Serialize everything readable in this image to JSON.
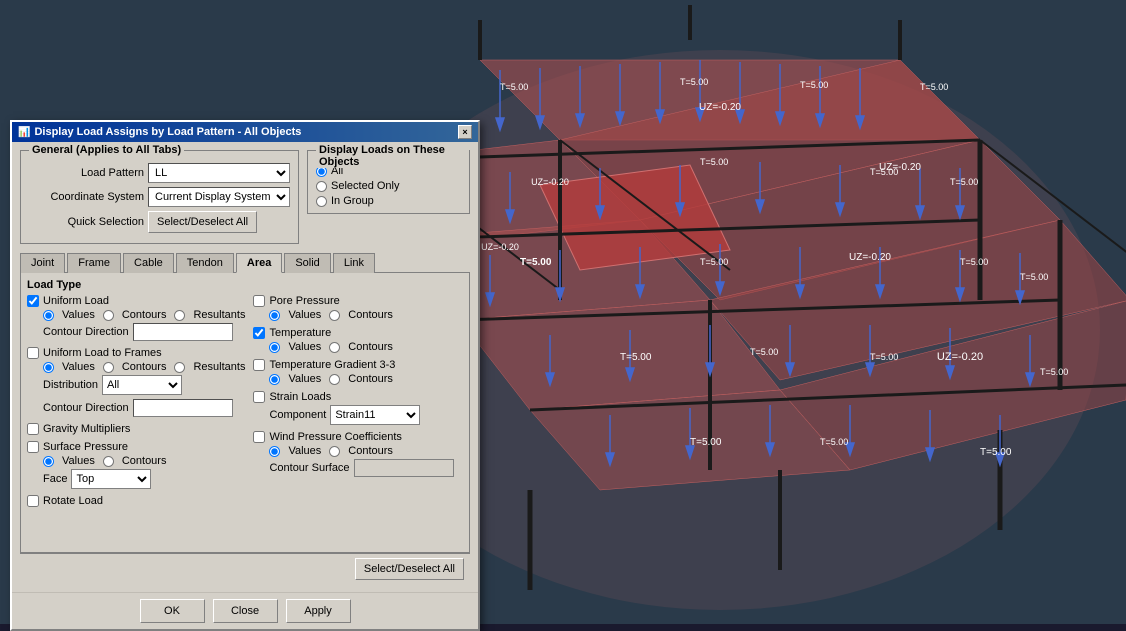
{
  "dialog": {
    "title": "Display Load Assigns by Load Pattern - All Objects",
    "close_btn": "×",
    "general_section_label": "General  (Applies to All Tabs)",
    "load_pattern_label": "Load Pattern",
    "load_pattern_value": "LL",
    "coordinate_system_label": "Coordinate System",
    "coordinate_system_value": "Current Display System",
    "quick_selection_label": "Quick Selection",
    "select_deselect_all_btn": "Select/Deselect All",
    "display_loads_label": "Display Loads on These Objects",
    "display_all": "All",
    "display_selected": "Selected Only",
    "display_in_group": "In Group",
    "tabs": [
      "Joint",
      "Frame",
      "Cable",
      "Tendon",
      "Area",
      "Solid",
      "Link"
    ],
    "active_tab": "Area",
    "load_type_label": "Load Type",
    "left_col": {
      "uniform_load": "Uniform Load",
      "uniform_values": "Values",
      "uniform_contours": "Contours",
      "uniform_resultants": "Resultants",
      "contour_direction": "Contour Direction",
      "uniform_load_to_frames": "Uniform Load to Frames",
      "utf_values": "Values",
      "utf_contours": "Contours",
      "utf_resultants": "Resultants",
      "distribution_label": "Distribution",
      "distribution_value": "All",
      "utf_contour_direction": "Contour Direction",
      "gravity_multipliers": "Gravity Multipliers",
      "surface_pressure": "Surface Pressure",
      "sp_values": "Values",
      "sp_contours": "Contours",
      "face_label": "Face",
      "face_value": "Top",
      "rotate_load": "Rotate Load"
    },
    "right_col": {
      "pore_pressure": "Pore Pressure",
      "pp_values": "Values",
      "pp_contours": "Contours",
      "temperature": "Temperature",
      "temp_values": "Values",
      "temp_contours": "Contours",
      "temperature_gradient": "Temperature Gradient 3-3",
      "tg_values": "Values",
      "tg_contours": "Contours",
      "strain_loads": "Strain Loads",
      "component_label": "Component",
      "component_value": "Strain11",
      "wind_pressure": "Wind Pressure Coefficients",
      "wp_values": "Values",
      "wp_contours": "Contours",
      "contour_surface_label": "Contour Surface",
      "contour_surface_value": ""
    },
    "select_deselect_all2": "Select/Deselect All",
    "ok_btn": "OK",
    "close_btn2": "Close",
    "apply_btn": "Apply"
  },
  "visualization": {
    "bg_color": "#2a3a4a",
    "labels": [
      "UZ=-0.20",
      "T=5.00"
    ],
    "accent_color": "#c05050"
  }
}
